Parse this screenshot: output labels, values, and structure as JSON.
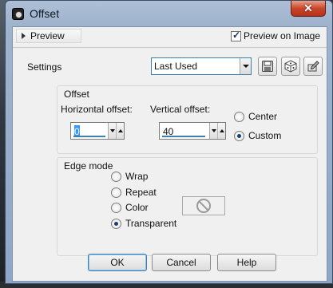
{
  "window": {
    "title": "Offset",
    "close_label": "✕"
  },
  "toolbar": {
    "preview_label": "Preview",
    "preview_on_image_label": "Preview on Image",
    "preview_on_image_checked": true
  },
  "settings": {
    "label": "Settings",
    "value": "Last Used"
  },
  "offset": {
    "group_label": "Offset",
    "horizontal_label": "Horizontal offset:",
    "horizontal_value": "0",
    "vertical_label": "Vertical offset:",
    "vertical_value": "40",
    "options": [
      {
        "label": "Center",
        "selected": false
      },
      {
        "label": "Custom",
        "selected": true
      }
    ]
  },
  "edge_mode": {
    "group_label": "Edge mode",
    "options": [
      {
        "label": "Wrap",
        "selected": false
      },
      {
        "label": "Repeat",
        "selected": false
      },
      {
        "label": "Color",
        "selected": false
      },
      {
        "label": "Transparent",
        "selected": true
      }
    ]
  },
  "buttons": {
    "ok": "OK",
    "cancel": "Cancel",
    "help": "Help"
  },
  "icons": {
    "save": "save-icon",
    "randomize": "dice-icon",
    "presets": "preset-manager-icon",
    "no_color": "no-symbol-icon"
  }
}
